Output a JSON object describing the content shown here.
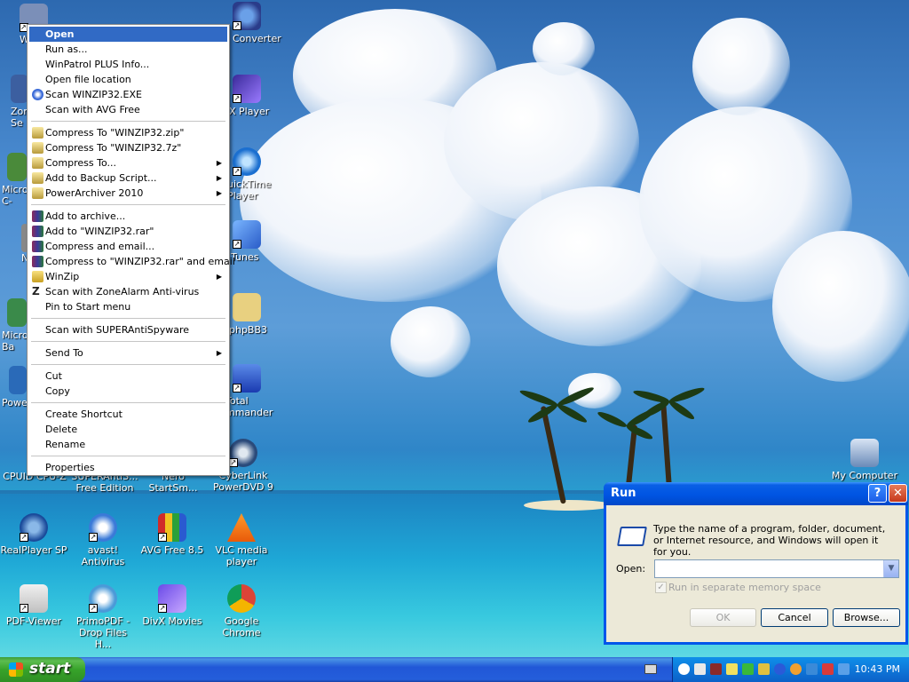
{
  "desktop_icons": [
    {
      "label": "W",
      "name": "desktop-icon-w"
    },
    {
      "label": "Converter",
      "name": "desktop-icon-converter"
    },
    {
      "label": "Zon Se",
      "name": "desktop-icon-zonealarm"
    },
    {
      "label": "X Player",
      "name": "desktop-icon-divx-player"
    },
    {
      "label": "Micros C-",
      "name": "desktop-icon-microsoft-c"
    },
    {
      "label": "uickTime Player",
      "name": "desktop-icon-quicktime"
    },
    {
      "label": "N",
      "name": "desktop-icon-n"
    },
    {
      "label": "Tunes",
      "name": "desktop-icon-itunes"
    },
    {
      "label": "Micros Ba",
      "name": "desktop-icon-microsoft-ba"
    },
    {
      "label": "phpBB3",
      "name": "desktop-icon-phpbb3"
    },
    {
      "label": "Powe",
      "name": "desktop-icon-power"
    },
    {
      "label": "Total mmander",
      "name": "desktop-icon-total-commander"
    },
    {
      "label": "CPUID CPU-Z",
      "name": "desktop-icon-cpuz"
    },
    {
      "label": "SUPERAntiS... Free Edition",
      "name": "desktop-icon-superantispyware"
    },
    {
      "label": "Nero StartSm...",
      "name": "desktop-icon-nero"
    },
    {
      "label": "CyberLink PowerDVD 9",
      "name": "desktop-icon-powerdvd"
    },
    {
      "label": "My Computer",
      "name": "desktop-icon-my-computer"
    },
    {
      "label": "RealPlayer SP",
      "name": "desktop-icon-realplayer"
    },
    {
      "label": "avast! Antivirus",
      "name": "desktop-icon-avast"
    },
    {
      "label": "AVG Free 8.5",
      "name": "desktop-icon-avg"
    },
    {
      "label": "VLC media player",
      "name": "desktop-icon-vlc"
    },
    {
      "label": "PDF-Viewer",
      "name": "desktop-icon-pdf-viewer"
    },
    {
      "label": "PrimoPDF - Drop Files H...",
      "name": "desktop-icon-primopdf"
    },
    {
      "label": "DivX Movies",
      "name": "desktop-icon-divx-movies"
    },
    {
      "label": "Google Chrome",
      "name": "desktop-icon-chrome"
    }
  ],
  "context_menu": {
    "items": [
      {
        "label": "Open"
      },
      {
        "label": "Run as..."
      },
      {
        "label": "WinPatrol PLUS Info..."
      },
      {
        "label": "Open file location"
      },
      {
        "label": "Scan WINZIP32.EXE"
      },
      {
        "label": "Scan with AVG Free"
      },
      {
        "label": "Compress To \"WINZIP32.zip\""
      },
      {
        "label": "Compress To \"WINZIP32.7z\""
      },
      {
        "label": "Compress To..."
      },
      {
        "label": "Add to Backup Script..."
      },
      {
        "label": "PowerArchiver 2010"
      },
      {
        "label": "Add to archive..."
      },
      {
        "label": "Add to \"WINZIP32.rar\""
      },
      {
        "label": "Compress and email..."
      },
      {
        "label": "Compress to \"WINZIP32.rar\" and email"
      },
      {
        "label": "WinZip"
      },
      {
        "label": "Scan with ZoneAlarm Anti-virus"
      },
      {
        "label": "Pin to Start menu"
      },
      {
        "label": "Scan with SUPERAntiSpyware"
      },
      {
        "label": "Send To"
      },
      {
        "label": "Cut"
      },
      {
        "label": "Copy"
      },
      {
        "label": "Create Shortcut"
      },
      {
        "label": "Delete"
      },
      {
        "label": "Rename"
      },
      {
        "label": "Properties"
      }
    ]
  },
  "run_dialog": {
    "title": "Run",
    "help_glyph": "?",
    "close_glyph": "✕",
    "description": "Type the name of a program, folder, document, or Internet resource, and Windows will open it for you.",
    "open_label": "Open:",
    "open_value": "",
    "checkbox_label": "Run in separate memory space",
    "checkbox_checked": true,
    "ok_label": "OK",
    "cancel_label": "Cancel",
    "browse_label": "Browse..."
  },
  "taskbar": {
    "start_label": "start",
    "clock": "10:43 PM"
  }
}
